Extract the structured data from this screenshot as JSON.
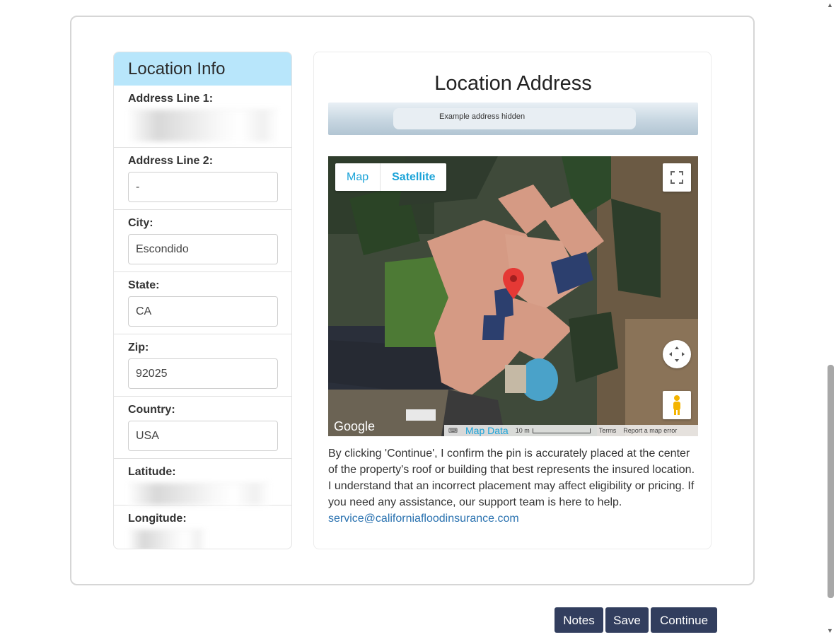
{
  "location_info": {
    "header": "Location Info",
    "fields": [
      {
        "label": "Address Line 1:",
        "value": null
      },
      {
        "label": "Address Line 2:",
        "value": "-"
      },
      {
        "label": "City:",
        "value": "Escondido"
      },
      {
        "label": "State:",
        "value": "CA"
      },
      {
        "label": "Zip:",
        "value": "92025"
      },
      {
        "label": "Country:",
        "value": "USA"
      },
      {
        "label": "Latitude:",
        "value": null
      },
      {
        "label": "Longitude:",
        "value": null
      }
    ]
  },
  "location_address": {
    "title": "Location Address",
    "address_placeholder": "Example address hidden",
    "map": {
      "type_map": "Map",
      "type_satellite": "Satellite",
      "google_logo": "Google",
      "map_data": "Map Data",
      "scale": "10 m",
      "terms": "Terms",
      "report": "Report a map error"
    },
    "disclaimer": "By clicking 'Continue', I confirm the pin is accurately placed at the center of the property's roof or building that best represents the insured location. I understand that an incorrect placement may affect eligibility or pricing. If you need any assistance, our support team is here to help.",
    "email": "service@californiafloodinsurance.com"
  },
  "actions": {
    "notes": "Notes",
    "save": "Save",
    "continue": "Continue"
  },
  "colors": {
    "panel_header_bg": "#b8e6fb",
    "button_bg": "#323e5e",
    "link": "#2a72b0",
    "map_toggle_text": "#1aa3d8",
    "pin": "#e53935"
  }
}
